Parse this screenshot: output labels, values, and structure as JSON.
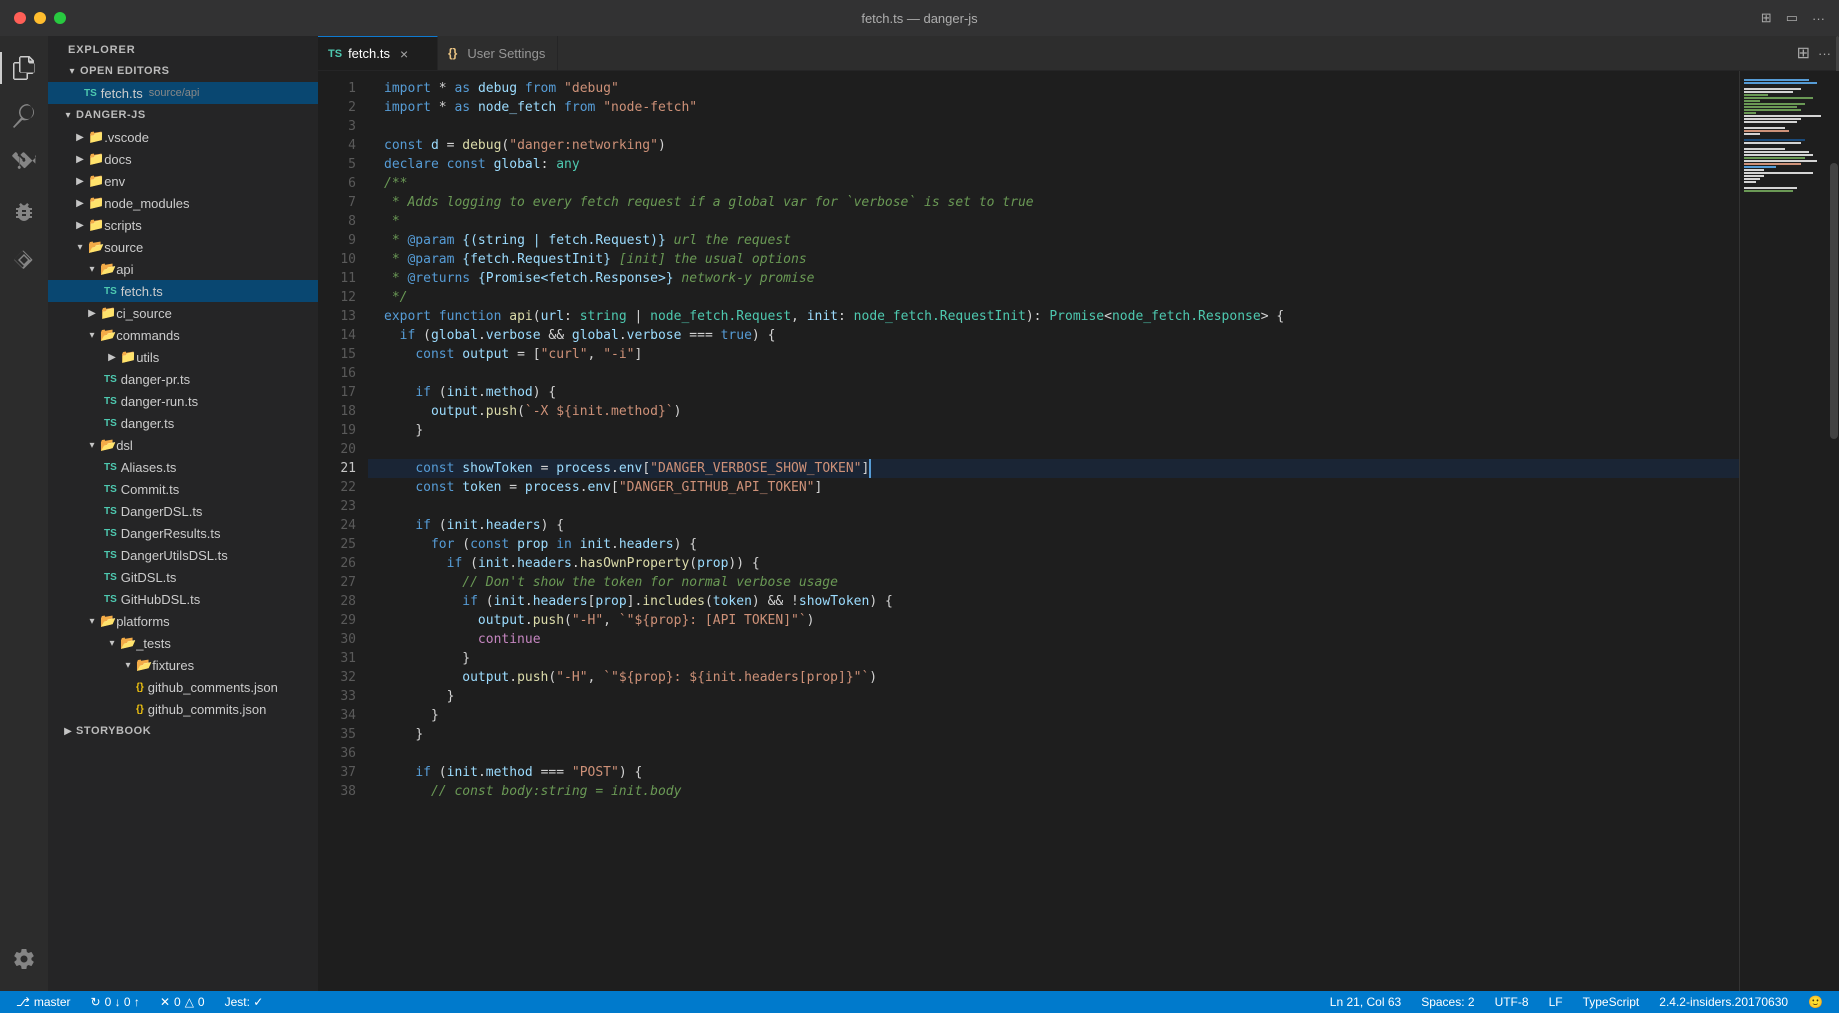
{
  "titlebar": {
    "title": "fetch.ts — danger-js",
    "traffic": [
      "red",
      "yellow",
      "green"
    ]
  },
  "tabs": [
    {
      "id": "fetch",
      "label": "fetch.ts",
      "type": "ts",
      "active": true,
      "closable": true
    },
    {
      "id": "settings",
      "label": "User Settings",
      "type": "json",
      "active": false,
      "closable": false
    }
  ],
  "sidebar": {
    "header": "Explorer",
    "sections": {
      "open_editors": {
        "label": "Open Editors",
        "items": [
          {
            "label": "fetch.ts",
            "path": "source/api",
            "type": "ts",
            "active": true
          }
        ]
      },
      "danger_js": {
        "label": "Danger-JS",
        "items": [
          {
            "label": ".vscode",
            "type": "folder",
            "indent": 1
          },
          {
            "label": "docs",
            "type": "folder",
            "indent": 1
          },
          {
            "label": "env",
            "type": "folder",
            "indent": 1
          },
          {
            "label": "node_modules",
            "type": "folder",
            "indent": 1
          },
          {
            "label": "scripts",
            "type": "folder",
            "indent": 1
          },
          {
            "label": "source",
            "type": "folder-open",
            "indent": 1
          },
          {
            "label": "api",
            "type": "folder-open",
            "indent": 2
          },
          {
            "label": "fetch.ts",
            "type": "ts",
            "indent": 3,
            "active": true
          },
          {
            "label": "ci_source",
            "type": "folder",
            "indent": 2
          },
          {
            "label": "commands",
            "type": "folder-open",
            "indent": 2
          },
          {
            "label": "utils",
            "type": "folder",
            "indent": 3
          },
          {
            "label": "danger-pr.ts",
            "type": "ts",
            "indent": 3
          },
          {
            "label": "danger-run.ts",
            "type": "ts",
            "indent": 3
          },
          {
            "label": "danger.ts",
            "type": "ts",
            "indent": 3
          },
          {
            "label": "dsl",
            "type": "folder-open",
            "indent": 2
          },
          {
            "label": "Aliases.ts",
            "type": "ts",
            "indent": 3
          },
          {
            "label": "Commit.ts",
            "type": "ts",
            "indent": 3
          },
          {
            "label": "DangerDSL.ts",
            "type": "ts",
            "indent": 3
          },
          {
            "label": "DangerResults.ts",
            "type": "ts",
            "indent": 3
          },
          {
            "label": "DangerUtilsDSL.ts",
            "type": "ts",
            "indent": 3
          },
          {
            "label": "GitDSL.ts",
            "type": "ts",
            "indent": 3
          },
          {
            "label": "GitHubDSL.ts",
            "type": "ts",
            "indent": 3
          },
          {
            "label": "platforms",
            "type": "folder-open",
            "indent": 2
          },
          {
            "label": "_tests",
            "type": "folder-open",
            "indent": 3
          },
          {
            "label": "fixtures",
            "type": "folder-open",
            "indent": 4
          },
          {
            "label": "github_comments.json",
            "type": "json",
            "indent": 5
          },
          {
            "label": "github_commits.json",
            "type": "json",
            "indent": 5
          }
        ]
      },
      "storybook": {
        "label": "Storybook",
        "collapsed": true
      }
    }
  },
  "code": {
    "filename": "fetch.ts",
    "lines": [
      {
        "n": 1,
        "content": "import_star_debug"
      },
      {
        "n": 2,
        "content": "import_star_nodefetch"
      },
      {
        "n": 3,
        "content": ""
      },
      {
        "n": 4,
        "content": "const_d_debug"
      },
      {
        "n": 5,
        "content": "declare_const_global"
      },
      {
        "n": 6,
        "content": "jsdoc_start"
      },
      {
        "n": 7,
        "content": "jsdoc_adds"
      },
      {
        "n": 8,
        "content": "jsdoc_asterisk"
      },
      {
        "n": 9,
        "content": "jsdoc_param_url"
      },
      {
        "n": 10,
        "content": "jsdoc_param_init"
      },
      {
        "n": 11,
        "content": "jsdoc_returns"
      },
      {
        "n": 12,
        "content": "jsdoc_end"
      },
      {
        "n": 13,
        "content": "export_function"
      },
      {
        "n": 14,
        "content": "if_global"
      },
      {
        "n": 15,
        "content": "const_output"
      },
      {
        "n": 16,
        "content": "blank"
      },
      {
        "n": 17,
        "content": "if_init_method"
      },
      {
        "n": 18,
        "content": "output_push_method"
      },
      {
        "n": 19,
        "content": "close_brace"
      },
      {
        "n": 20,
        "content": "blank"
      },
      {
        "n": 21,
        "content": "const_showToken",
        "cursor": true
      },
      {
        "n": 22,
        "content": "const_token"
      },
      {
        "n": 23,
        "content": "blank"
      },
      {
        "n": 24,
        "content": "if_init_headers"
      },
      {
        "n": 25,
        "content": "for_const_prop"
      },
      {
        "n": 26,
        "content": "if_hasOwnProperty"
      },
      {
        "n": 27,
        "content": "comment_dont_show"
      },
      {
        "n": 28,
        "content": "if_includes_token"
      },
      {
        "n": 29,
        "content": "output_push_H_apitoken"
      },
      {
        "n": 30,
        "content": "continue_stmt"
      },
      {
        "n": 31,
        "content": "close_brace_inner"
      },
      {
        "n": 32,
        "content": "output_push_H_prop"
      },
      {
        "n": 33,
        "content": "close_brace_for"
      },
      {
        "n": 34,
        "content": "close_brace_outer"
      },
      {
        "n": 35,
        "content": "close_brace_if"
      },
      {
        "n": 36,
        "content": "blank"
      },
      {
        "n": 37,
        "content": "if_init_method_post"
      },
      {
        "n": 38,
        "content": "comment_const_body"
      }
    ]
  },
  "statusbar": {
    "branch": "master",
    "sync": "0 ↓ 0 ↑",
    "errors": "0",
    "warnings": "0",
    "jest": "Jest: ✓",
    "cursor": "Ln 21, Col 63",
    "spaces": "Spaces: 2",
    "encoding": "UTF-8",
    "eol": "LF",
    "language": "TypeScript",
    "version": "2.4.2-insiders.20170630",
    "smiley": "🙂"
  },
  "icons": {
    "files": "📄",
    "search": "🔍",
    "git": "⎇",
    "debug": "🐛",
    "extensions": "⧉",
    "settings": "⚙",
    "split": "⊞",
    "ellipsis": "···"
  }
}
